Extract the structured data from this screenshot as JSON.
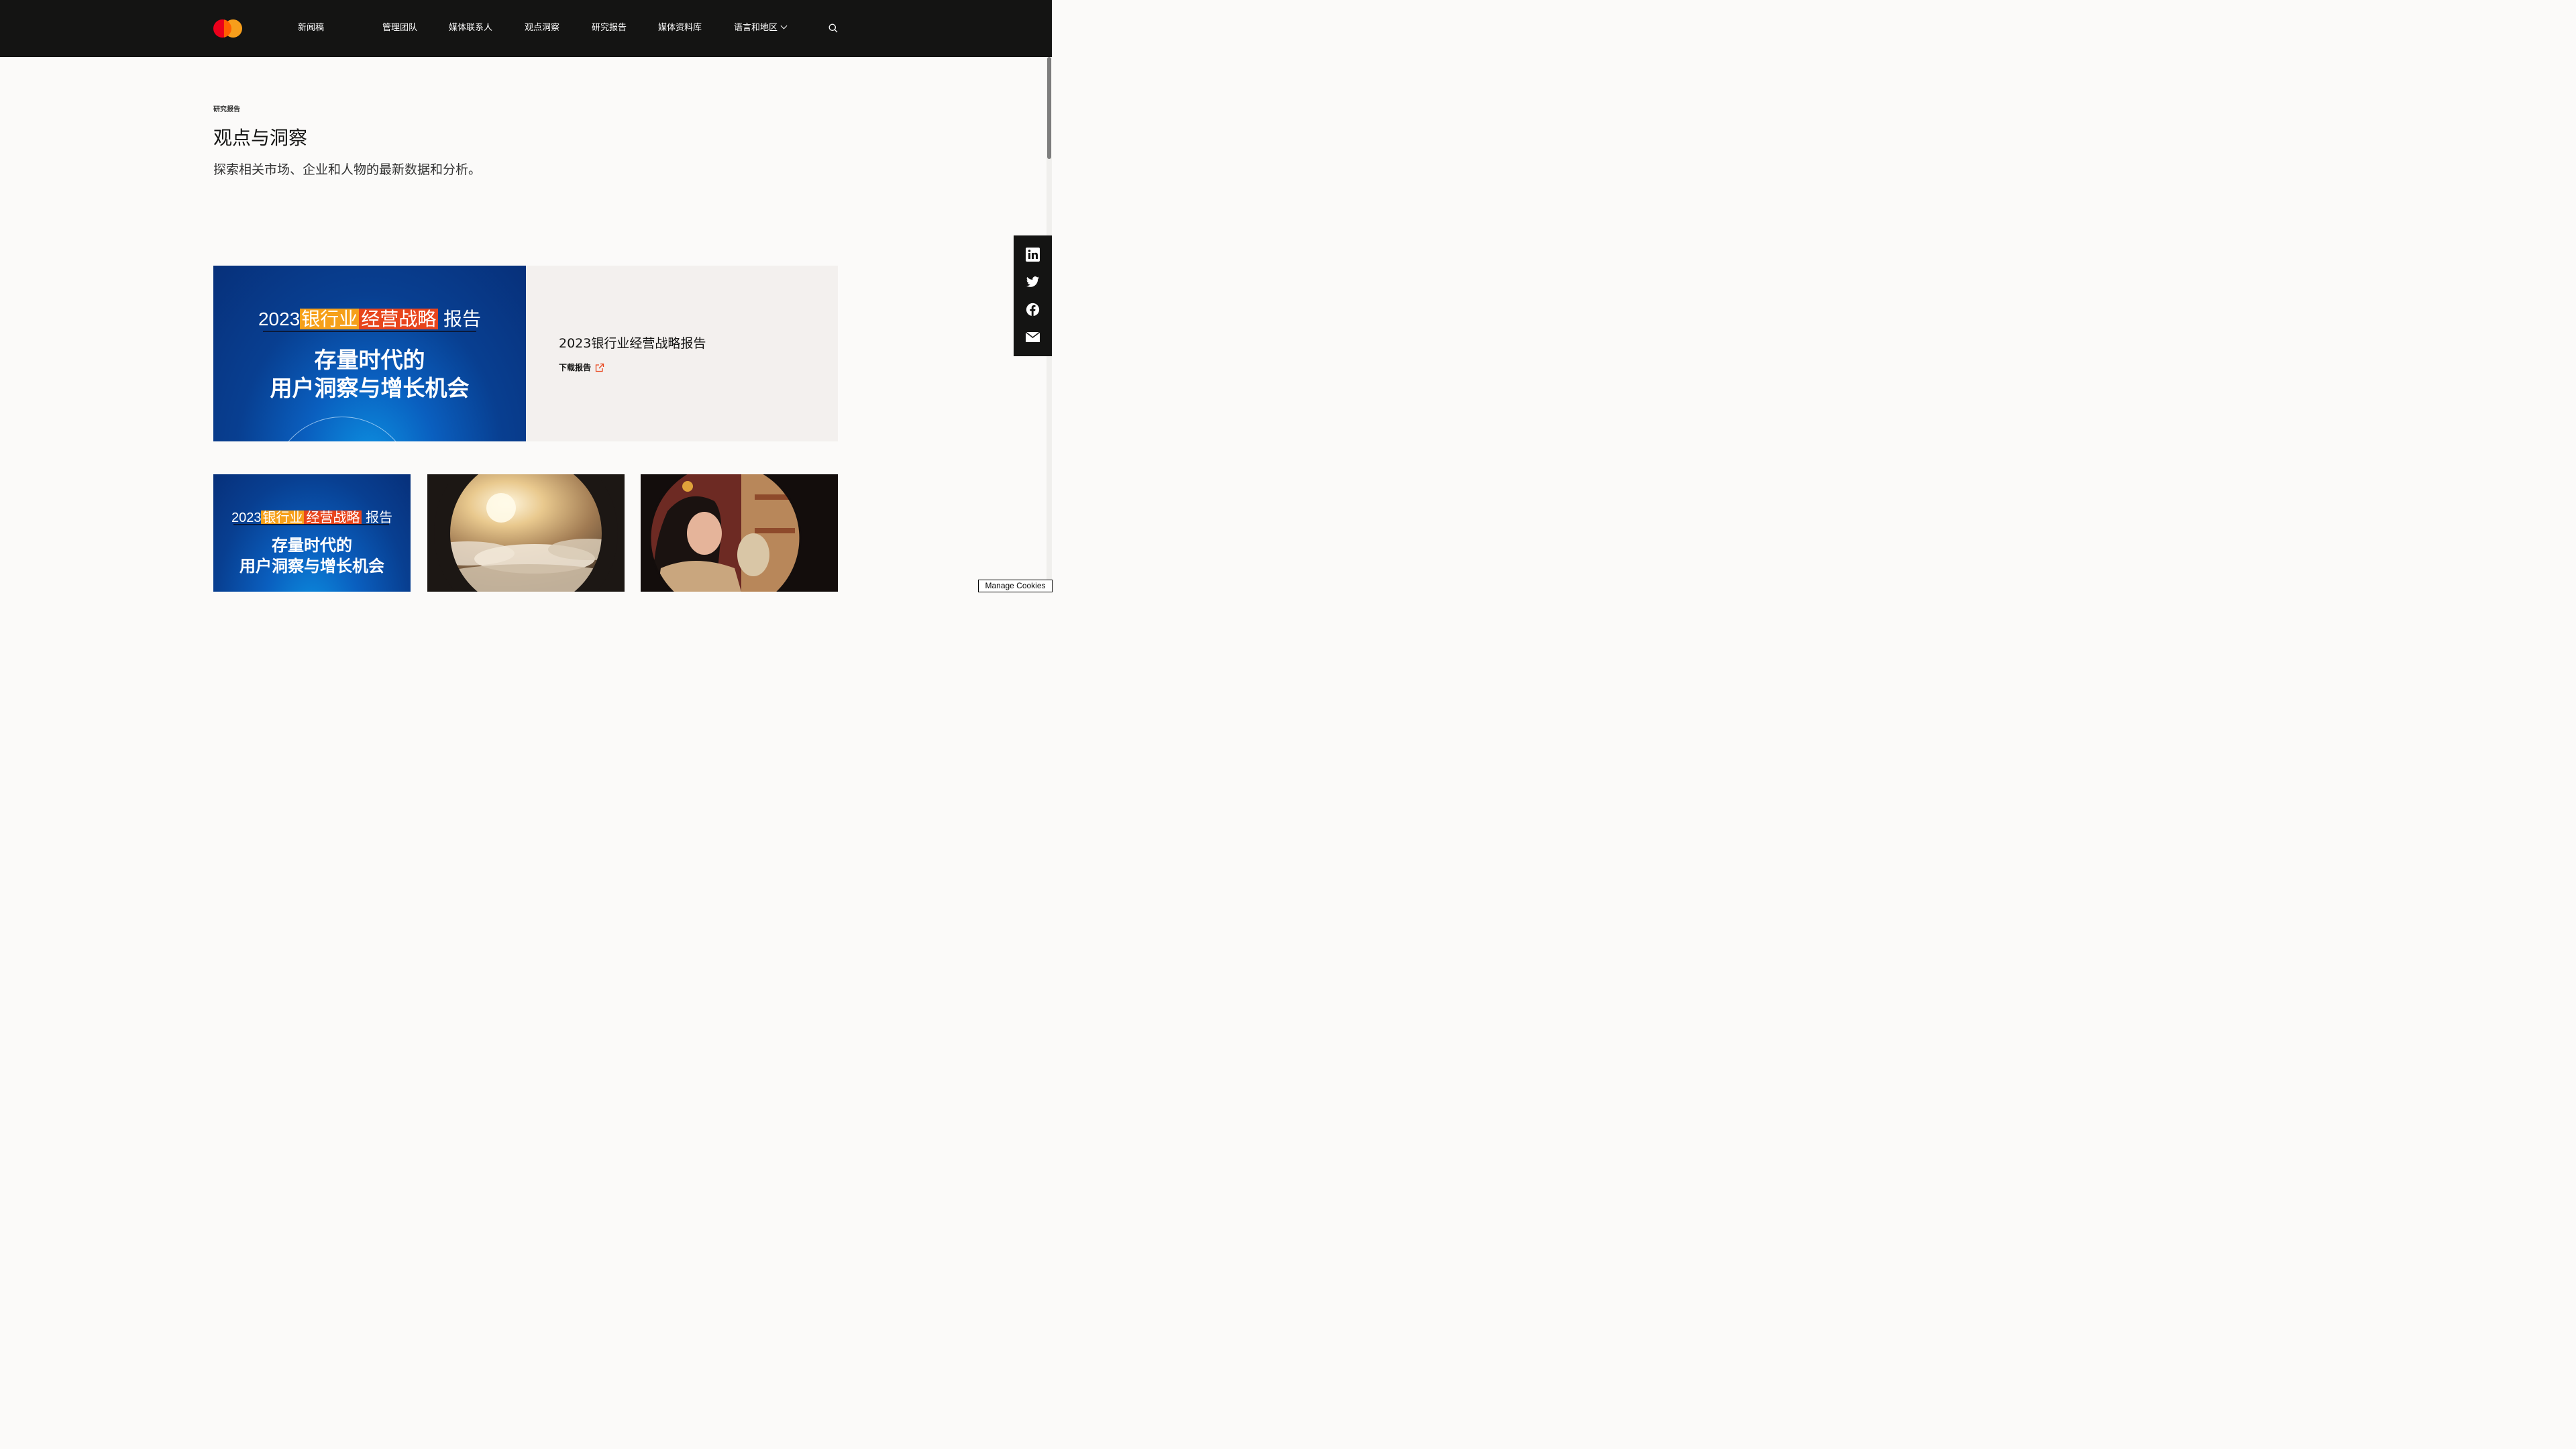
{
  "nav": {
    "items": [
      {
        "label": "新闻稿"
      },
      {
        "label": "管理团队"
      },
      {
        "label": "媒体联系人"
      },
      {
        "label": "观点洞察"
      },
      {
        "label": "研究报告"
      },
      {
        "label": "媒体资料库"
      },
      {
        "label": "语言和地区"
      }
    ]
  },
  "page": {
    "eyebrow": "研究报告",
    "title": "观点与洞察",
    "subtitle": "探索相关市场、企业和人物的最新数据和分析。"
  },
  "feature": {
    "title": "2023银行业经营战略报告",
    "download_label": "下载报告",
    "cover": {
      "year": "2023",
      "highlight_a": "银行业",
      "highlight_b": "经营战略",
      "suffix": "报告",
      "line2": "存量时代的",
      "line3": "用户洞察与增长机会"
    }
  },
  "cards": [
    {
      "cover": {
        "year": "2023",
        "highlight_a": "银行业",
        "highlight_b": "经营战略",
        "suffix": "报告",
        "line2": "存量时代的",
        "line3": "用户洞察与增长机会"
      }
    },
    {
      "icon": "clouds-sunrise-image"
    },
    {
      "icon": "woman-shopping-image"
    }
  ],
  "share": {
    "icons": [
      "linkedin-icon",
      "twitter-icon",
      "facebook-icon",
      "email-icon"
    ]
  },
  "cookies": {
    "label": "Manage Cookies"
  },
  "colors": {
    "nav_bg": "#141413",
    "page_bg": "#fbfaf9",
    "panel_bg": "#f3f0ee",
    "accent_red": "#eb001b",
    "accent_orange": "#f79e1b",
    "cover_blue": "#083f91"
  }
}
